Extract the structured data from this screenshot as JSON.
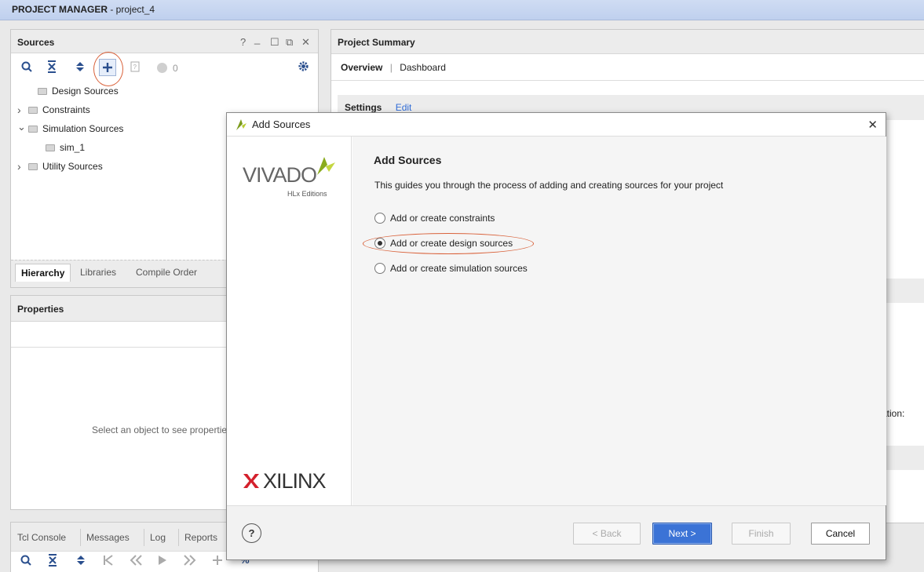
{
  "window": {
    "title_bold": "PROJECT MANAGER",
    "title_rest": " - project_4"
  },
  "sources": {
    "title": "Sources",
    "controls": [
      "?",
      "_",
      "☐",
      "⧉",
      "✕"
    ],
    "badge_count": "0",
    "tree": [
      {
        "label": "Design Sources",
        "arrow": ""
      },
      {
        "label": "Constraints",
        "arrow": "›"
      },
      {
        "label": "Simulation Sources",
        "arrow": "⌄"
      },
      {
        "label": "sim_1",
        "arrow": ""
      },
      {
        "label": "Utility Sources",
        "arrow": "›"
      }
    ],
    "tabs": [
      "Hierarchy",
      "Libraries",
      "Compile Order"
    ]
  },
  "properties": {
    "title": "Properties",
    "empty_message": "Select an object to see properties"
  },
  "console": {
    "tabs": [
      "Tcl Console",
      "Messages",
      "Log",
      "Reports"
    ]
  },
  "summary": {
    "title": "Project Summary",
    "tabs": [
      "Overview",
      "Dashboard"
    ],
    "settings_label": "Settings",
    "edit_link": "Edit",
    "partial_text": "ation:"
  },
  "dialog": {
    "title": "Add Sources",
    "close": "✕",
    "logo_vivado": "VIVADO",
    "logo_vivado_sub": "HLx Editions",
    "logo_xilinx": "XILINX",
    "heading": "Add Sources",
    "description": "This guides you through the process of adding and creating sources for your project",
    "options": [
      {
        "label": "Add or create constraints",
        "selected": false
      },
      {
        "label": "Add or create design sources",
        "selected": true
      },
      {
        "label": "Add or create simulation sources",
        "selected": false
      }
    ],
    "help": "?",
    "buttons": {
      "back": "< Back",
      "next": "Next >",
      "finish": "Finish",
      "cancel": "Cancel"
    }
  },
  "colors": {
    "accent": "#3b73d6",
    "annotation": "#d9623b",
    "link": "#2f6bd6"
  }
}
